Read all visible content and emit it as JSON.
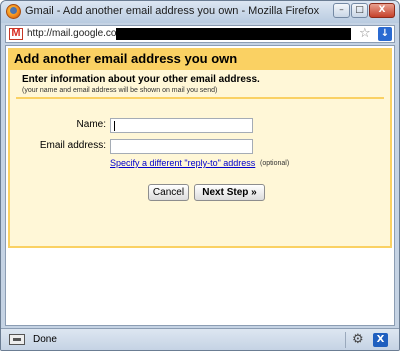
{
  "window": {
    "title": "Gmail - Add another email address you own - Mozilla Firefox",
    "controls": {
      "minimize": "–",
      "maximize": "□",
      "close": "X"
    }
  },
  "addressbar": {
    "url": "http://mail.google.com",
    "star_glyph": "☆",
    "feed_glyph": "↓"
  },
  "dialog": {
    "title": "Add another email address you own",
    "intro": "Enter information about your other email address.",
    "intro_sub": "(your name and email address will be shown on mail you send)",
    "fields": {
      "name_label": "Name:",
      "name_value": "",
      "email_label": "Email address:",
      "email_value": ""
    },
    "replyto_link": "Specify a different \"reply-to\" address",
    "optional": "(optional)",
    "buttons": {
      "cancel": "Cancel",
      "next": "Next Step »"
    }
  },
  "statusbar": {
    "text": "Done",
    "gear_glyph": "⚙",
    "xmarks_glyph": "X"
  },
  "colors": {
    "header_yellow": "#fad163",
    "body_cream": "#fff7d7",
    "link_blue": "#0000cc",
    "chrome_blue": "#c5d3e4"
  }
}
